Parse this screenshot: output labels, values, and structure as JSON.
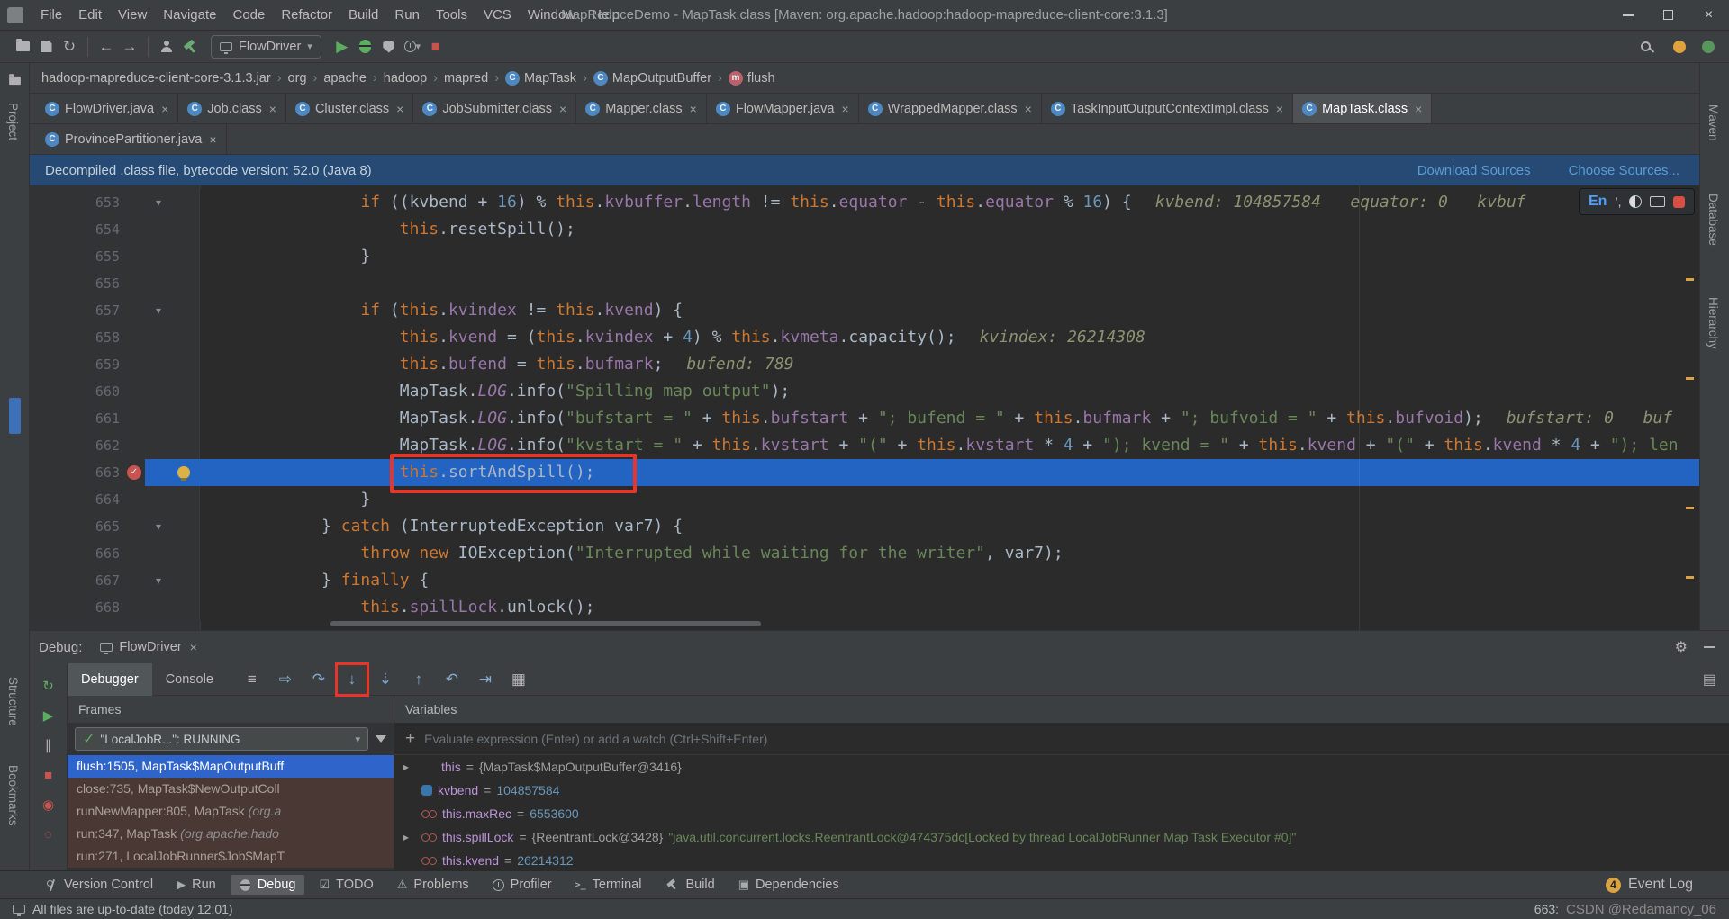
{
  "titlebar": {
    "menus": [
      "File",
      "Edit",
      "View",
      "Navigate",
      "Code",
      "Refactor",
      "Build",
      "Run",
      "Tools",
      "VCS",
      "Window",
      "Help"
    ],
    "title": "MapReduceDemo - MapTask.class [Maven: org.apache.hadoop:hadoop-mapreduce-client-core:3.1.3]"
  },
  "toolbar": {
    "run_config": "FlowDriver"
  },
  "breadcrumbs": {
    "items": [
      {
        "label": "hadoop-mapreduce-client-core-3.1.3.jar"
      },
      {
        "label": "org"
      },
      {
        "label": "apache"
      },
      {
        "label": "hadoop"
      },
      {
        "label": "mapred"
      },
      {
        "label": "MapTask",
        "icon": "class"
      },
      {
        "label": "MapOutputBuffer",
        "icon": "class"
      },
      {
        "label": "flush",
        "icon": "method"
      }
    ]
  },
  "editor_tabs": {
    "row1": [
      {
        "label": "FlowDriver.java"
      },
      {
        "label": "Job.class"
      },
      {
        "label": "Cluster.class"
      },
      {
        "label": "JobSubmitter.class"
      },
      {
        "label": "Mapper.class"
      },
      {
        "label": "FlowMapper.java"
      },
      {
        "label": "WrappedMapper.class"
      },
      {
        "label": "TaskInputOutputContextImpl.class"
      },
      {
        "label": "MapTask.class",
        "selected": true
      }
    ],
    "row2": [
      {
        "label": "ProvincePartitioner.java"
      }
    ]
  },
  "banner": {
    "text": "Decompiled .class file, bytecode version: 52.0 (Java 8)",
    "links": [
      "Download Sources",
      "Choose Sources..."
    ]
  },
  "editor": {
    "lines": [
      {
        "no": 653,
        "indent": 16,
        "fold": true,
        "segs": [
          [
            "k",
            "if"
          ],
          [
            "p",
            " (("
          ],
          [
            "p",
            "kvbend"
          ],
          [
            "p",
            " + "
          ],
          [
            "n",
            "16"
          ],
          [
            "p",
            ") % "
          ],
          [
            "k",
            "this"
          ],
          [
            "p",
            "."
          ],
          [
            "f",
            "kvbuffer"
          ],
          [
            "p",
            "."
          ],
          [
            "f",
            "length"
          ],
          [
            "p",
            " != "
          ],
          [
            "k",
            "this"
          ],
          [
            "p",
            "."
          ],
          [
            "f",
            "equator"
          ],
          [
            "p",
            " - "
          ],
          [
            "k",
            "this"
          ],
          [
            "p",
            "."
          ],
          [
            "f",
            "equator"
          ],
          [
            "p",
            " % "
          ],
          [
            "n",
            "16"
          ],
          [
            "p",
            ") {"
          ]
        ],
        "hint": "kvbend: 104857584   equator: 0   kvbuf"
      },
      {
        "no": 654,
        "indent": 20,
        "segs": [
          [
            "k",
            "this"
          ],
          [
            "p",
            ".resetSpill();"
          ]
        ]
      },
      {
        "no": 655,
        "indent": 16,
        "segs": [
          [
            "p",
            "}"
          ]
        ]
      },
      {
        "no": 656,
        "indent": 0,
        "segs": []
      },
      {
        "no": 657,
        "indent": 16,
        "fold": true,
        "segs": [
          [
            "k",
            "if"
          ],
          [
            "p",
            " ("
          ],
          [
            "k",
            "this"
          ],
          [
            "p",
            "."
          ],
          [
            "f",
            "kvindex"
          ],
          [
            "p",
            " != "
          ],
          [
            "k",
            "this"
          ],
          [
            "p",
            "."
          ],
          [
            "f",
            "kvend"
          ],
          [
            "p",
            ") {"
          ]
        ]
      },
      {
        "no": 658,
        "indent": 20,
        "segs": [
          [
            "k",
            "this"
          ],
          [
            "p",
            "."
          ],
          [
            "f",
            "kvend"
          ],
          [
            "p",
            " = ("
          ],
          [
            "k",
            "this"
          ],
          [
            "p",
            "."
          ],
          [
            "f",
            "kvindex"
          ],
          [
            "p",
            " + "
          ],
          [
            "n",
            "4"
          ],
          [
            "p",
            ") % "
          ],
          [
            "k",
            "this"
          ],
          [
            "p",
            "."
          ],
          [
            "f",
            "kvmeta"
          ],
          [
            "p",
            ".capacity();"
          ]
        ],
        "hint": "kvindex: 26214308"
      },
      {
        "no": 659,
        "indent": 20,
        "segs": [
          [
            "k",
            "this"
          ],
          [
            "p",
            "."
          ],
          [
            "f",
            "bufend"
          ],
          [
            "p",
            " = "
          ],
          [
            "k",
            "this"
          ],
          [
            "p",
            "."
          ],
          [
            "f",
            "bufmark"
          ],
          [
            "p",
            ";"
          ]
        ],
        "hint": "bufend: 789"
      },
      {
        "no": 660,
        "indent": 20,
        "segs": [
          [
            "p",
            "MapTask."
          ],
          [
            "sf",
            "LOG"
          ],
          [
            "p",
            ".info("
          ],
          [
            "s",
            "\"Spilling map output\""
          ],
          [
            "p",
            ");"
          ]
        ]
      },
      {
        "no": 661,
        "indent": 20,
        "segs": [
          [
            "p",
            "MapTask."
          ],
          [
            "sf",
            "LOG"
          ],
          [
            "p",
            ".info("
          ],
          [
            "s",
            "\"bufstart = \""
          ],
          [
            "p",
            " + "
          ],
          [
            "k",
            "this"
          ],
          [
            "p",
            "."
          ],
          [
            "f",
            "bufstart"
          ],
          [
            "p",
            " + "
          ],
          [
            "s",
            "\"; bufend = \""
          ],
          [
            "p",
            " + "
          ],
          [
            "k",
            "this"
          ],
          [
            "p",
            "."
          ],
          [
            "f",
            "bufmark"
          ],
          [
            "p",
            " + "
          ],
          [
            "s",
            "\"; bufvoid = \""
          ],
          [
            "p",
            " + "
          ],
          [
            "k",
            "this"
          ],
          [
            "p",
            "."
          ],
          [
            "f",
            "bufvoid"
          ],
          [
            "p",
            ");"
          ]
        ],
        "hint": "bufstart: 0   buf"
      },
      {
        "no": 662,
        "indent": 20,
        "segs": [
          [
            "p",
            "MapTask."
          ],
          [
            "sf",
            "LOG"
          ],
          [
            "p",
            ".info("
          ],
          [
            "s",
            "\"kvstart = \""
          ],
          [
            "p",
            " + "
          ],
          [
            "k",
            "this"
          ],
          [
            "p",
            "."
          ],
          [
            "f",
            "kvstart"
          ],
          [
            "p",
            " + "
          ],
          [
            "s",
            "\"(\""
          ],
          [
            "p",
            " + "
          ],
          [
            "k",
            "this"
          ],
          [
            "p",
            "."
          ],
          [
            "f",
            "kvstart"
          ],
          [
            "p",
            " * "
          ],
          [
            "n",
            "4"
          ],
          [
            "p",
            " + "
          ],
          [
            "s",
            "\"); kvend = \""
          ],
          [
            "p",
            " + "
          ],
          [
            "k",
            "this"
          ],
          [
            "p",
            "."
          ],
          [
            "f",
            "kvend"
          ],
          [
            "p",
            " + "
          ],
          [
            "s",
            "\"(\""
          ],
          [
            "p",
            " + "
          ],
          [
            "k",
            "this"
          ],
          [
            "p",
            "."
          ],
          [
            "f",
            "kvend"
          ],
          [
            "p",
            " * "
          ],
          [
            "n",
            "4"
          ],
          [
            "p",
            " + "
          ],
          [
            "s",
            "\"); len"
          ]
        ]
      },
      {
        "no": 663,
        "indent": 20,
        "exec": true,
        "breakpoint": true,
        "bulb": true,
        "annotated": true,
        "segs": [
          [
            "k",
            "this"
          ],
          [
            "p",
            ".sortAndSpill();"
          ]
        ]
      },
      {
        "no": 664,
        "indent": 16,
        "segs": [
          [
            "p",
            "}"
          ]
        ]
      },
      {
        "no": 665,
        "indent": 12,
        "fold": true,
        "segs": [
          [
            "p",
            "} "
          ],
          [
            "k",
            "catch"
          ],
          [
            "p",
            " (InterruptedException var7) {"
          ]
        ]
      },
      {
        "no": 666,
        "indent": 16,
        "segs": [
          [
            "k",
            "throw"
          ],
          [
            "p",
            " "
          ],
          [
            "k",
            "new"
          ],
          [
            "p",
            " IOException("
          ],
          [
            "s",
            "\"Interrupted while waiting for the writer\""
          ],
          [
            "p",
            ", var7);"
          ]
        ]
      },
      {
        "no": 667,
        "indent": 12,
        "fold": true,
        "segs": [
          [
            "p",
            "} "
          ],
          [
            "k",
            "finally"
          ],
          [
            "p",
            " {"
          ]
        ]
      },
      {
        "no": 668,
        "indent": 16,
        "segs": [
          [
            "k",
            "this"
          ],
          [
            "p",
            "."
          ],
          [
            "f",
            "spillLock"
          ],
          [
            "p",
            ".unlock();"
          ]
        ]
      }
    ]
  },
  "ime": {
    "mode": "En",
    "punct": "’,"
  },
  "debug": {
    "title": "Debug:",
    "session_tab": "FlowDriver",
    "tabs": [
      {
        "label": "Debugger",
        "selected": true
      },
      {
        "label": "Console"
      }
    ],
    "step_icons": [
      {
        "name": "restore-layout-icon"
      },
      {
        "name": "show-execution-point-icon"
      },
      {
        "name": "step-over-icon"
      },
      {
        "name": "step-into-icon",
        "annotated": true
      },
      {
        "name": "force-step-into-icon"
      },
      {
        "name": "step-out-icon"
      },
      {
        "name": "drop-frame-icon"
      },
      {
        "name": "run-to-cursor-icon"
      },
      {
        "name": "evaluate-expression-icon"
      }
    ],
    "side_icons": [
      {
        "name": "rerun-icon"
      },
      {
        "name": "resume-icon"
      },
      {
        "name": "pause-icon"
      },
      {
        "name": "stop-icon"
      },
      {
        "name": "view-breakpoints-icon"
      },
      {
        "name": "mute-breakpoints-icon"
      }
    ],
    "frames": {
      "header": "Frames",
      "thread": "\"LocalJobR...\": RUNNING",
      "items": [
        {
          "text": "flush:1505, MapTask$MapOutputBuff",
          "selected": true
        },
        {
          "text": "close:735, MapTask$NewOutputColl",
          "lib": true
        },
        {
          "text": "runNewMapper:805, MapTask ",
          "suffix": "(org.a",
          "lib": true
        },
        {
          "text": "run:347, MapTask ",
          "suffix": "(org.apache.hado",
          "lib": true
        },
        {
          "text": "run:271, LocalJobRunner$Job$MapT",
          "lib": true
        }
      ]
    },
    "variables": {
      "header": "Variables",
      "placeholder": "Evaluate expression (Enter) or add a watch (Ctrl+Shift+Enter)",
      "rows": [
        {
          "expand": true,
          "icon": null,
          "name": "this",
          "parts": [
            [
              "p",
              " = "
            ],
            [
              "v",
              "{MapTask$MapOutputBuffer@3416}"
            ]
          ]
        },
        {
          "icon": "watch-inline",
          "name": "kvbend",
          "parts": [
            [
              "p",
              " = "
            ],
            [
              "n",
              "104857584"
            ]
          ]
        },
        {
          "icon": "watch",
          "name": "this.maxRec",
          "parts": [
            [
              "p",
              " = "
            ],
            [
              "n",
              "6553600"
            ]
          ]
        },
        {
          "expand": true,
          "icon": "watch",
          "name": "this.spillLock",
          "parts": [
            [
              "p",
              " = "
            ],
            [
              "v",
              "{ReentrantLock@3428} "
            ],
            [
              "s",
              "\"java.util.concurrent.locks.ReentrantLock@474375dc[Locked by thread LocalJobRunner Map Task Executor #0]\""
            ]
          ]
        },
        {
          "icon": "watch",
          "name": "this.kvend",
          "parts": [
            [
              "p",
              " = "
            ],
            [
              "n",
              "26214312"
            ]
          ]
        }
      ]
    }
  },
  "bottom_bar": {
    "items": [
      {
        "label": "Version Control",
        "icon": "branch"
      },
      {
        "label": "Run",
        "icon": "run"
      },
      {
        "label": "Debug",
        "icon": "debug",
        "selected": true
      },
      {
        "label": "TODO",
        "icon": "todo"
      },
      {
        "label": "Problems",
        "icon": "problems"
      },
      {
        "label": "Profiler",
        "icon": "profiler"
      },
      {
        "label": "Terminal",
        "icon": "terminal"
      },
      {
        "label": "Build",
        "icon": "build"
      },
      {
        "label": "Dependencies",
        "icon": "dependencies"
      }
    ],
    "event_log": {
      "badge": "4",
      "label": "Event Log"
    }
  },
  "status_bar": {
    "message": "All files are up-to-date (today 12:01)",
    "position": "663:",
    "watermark": "CSDN @Redamancy_06"
  },
  "stripes": {
    "left": [
      {
        "label": "Project"
      },
      {
        "label": "Structure"
      },
      {
        "label": "Bookmarks"
      }
    ],
    "right": [
      {
        "label": "Maven"
      },
      {
        "label": "Database"
      },
      {
        "label": "Hierarchy"
      }
    ]
  },
  "colors": {
    "execution_line": "#2363c1",
    "selected_frame": "#2f65ca",
    "annotation_red": "#e8352b",
    "banner_blue": "#264a73"
  }
}
